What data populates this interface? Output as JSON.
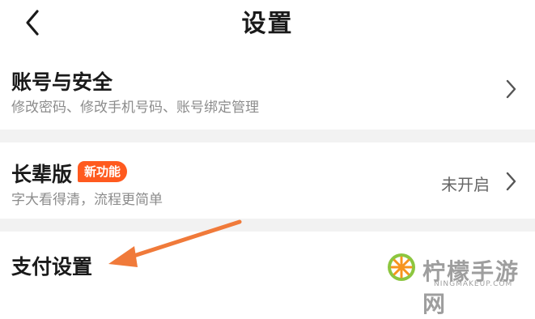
{
  "header": {
    "title": "设置",
    "back_icon": "chevron-left-icon"
  },
  "account": {
    "title": "账号与安全",
    "subtitle": "修改密码、修改手机号码、账号绑定管理"
  },
  "elder": {
    "title": "长辈版",
    "badge": "新功能",
    "subtitle": "字大看得清，流程更简单",
    "status": "未开启"
  },
  "payment": {
    "title": "支付设置"
  },
  "watermark": {
    "text": "柠檬手游网",
    "sub": "NINGMAKEUP.COM"
  },
  "colors": {
    "accent": "#ff5a1f",
    "arrow": "#f07a3a",
    "divider": "#f2f2f2",
    "muted": "#8c8c8c"
  }
}
